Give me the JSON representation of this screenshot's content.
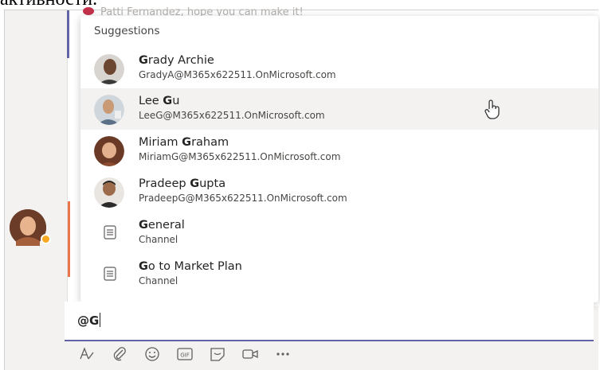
{
  "caption_top": "активности.",
  "preview_message": "Patti Fernandez, hope you can make it!",
  "suggestions": {
    "title": "Suggestions",
    "items": [
      {
        "name_bold": "G",
        "name_rest": "rady Archie",
        "name_pre": "",
        "sub": "GradyA@M365x622511.OnMicrosoft.com",
        "kind": "person"
      },
      {
        "name_pre": "Lee ",
        "name_bold": "G",
        "name_rest": "u",
        "sub": "LeeG@M365x622511.OnMicrosoft.com",
        "kind": "person"
      },
      {
        "name_pre": "Miriam ",
        "name_bold": "G",
        "name_rest": "raham",
        "sub": "MiriamG@M365x622511.OnMicrosoft.com",
        "kind": "person"
      },
      {
        "name_pre": "Pradeep ",
        "name_bold": "G",
        "name_rest": "upta",
        "sub": "PradeepG@M365x622511.OnMicrosoft.com",
        "kind": "person"
      },
      {
        "name_pre": "",
        "name_bold": "G",
        "name_rest": "eneral",
        "sub": "Channel",
        "kind": "channel"
      },
      {
        "name_pre": "",
        "name_bold": "G",
        "name_rest": "o to Market Plan",
        "sub": "Channel",
        "kind": "channel"
      }
    ]
  },
  "compose": {
    "value": "@G"
  },
  "toolbar": [
    "format-icon",
    "attach-icon",
    "emoji-icon",
    "gif-icon",
    "sticker-icon",
    "meet-now-icon",
    "more-icon"
  ],
  "colors": {
    "accent": "#6264a7",
    "hover": "#f3f2f1",
    "presence_away": "#f8a721"
  }
}
